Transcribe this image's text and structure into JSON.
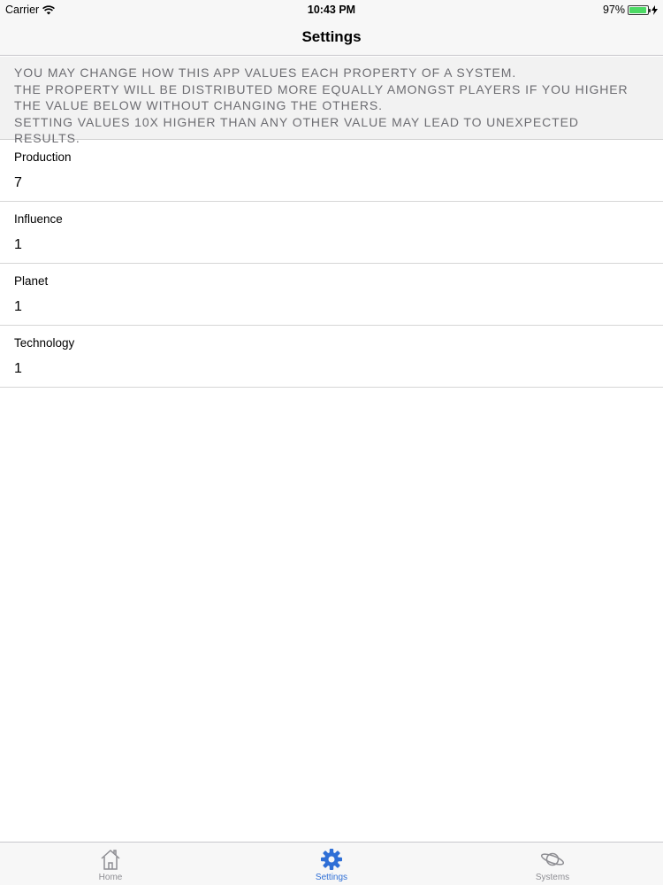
{
  "status_bar": {
    "carrier": "Carrier",
    "time": "10:43 PM",
    "battery": "97%",
    "battery_level": 0.97
  },
  "nav": {
    "title": "Settings"
  },
  "note": {
    "lines": [
      "YOU MAY CHANGE HOW THIS APP VALUES EACH PROPERTY OF A SYSTEM.",
      "THE PROPERTY WILL BE DISTRIBUTED MORE EQUALLY AMONGST PLAYERS IF YOU HIGHER THE VALUE BELOW WITHOUT CHANGING THE OTHERS.",
      "SETTING VALUES 10X HIGHER THAN ANY OTHER VALUE MAY LEAD TO UNEXPECTED RESULTS."
    ]
  },
  "properties": [
    {
      "label": "Production",
      "value": "7"
    },
    {
      "label": "Influence",
      "value": "1"
    },
    {
      "label": "Planet",
      "value": "1"
    },
    {
      "label": "Technology",
      "value": "1"
    }
  ],
  "tabs": [
    {
      "label": "Home",
      "icon": "home-icon",
      "active": false
    },
    {
      "label": "Settings",
      "icon": "gear-icon",
      "active": true
    },
    {
      "label": "Systems",
      "icon": "planet-icon",
      "active": false
    }
  ],
  "colors": {
    "accent": "#2f6fd6",
    "inactive": "#8e8e93",
    "battery": "#4cd964"
  }
}
